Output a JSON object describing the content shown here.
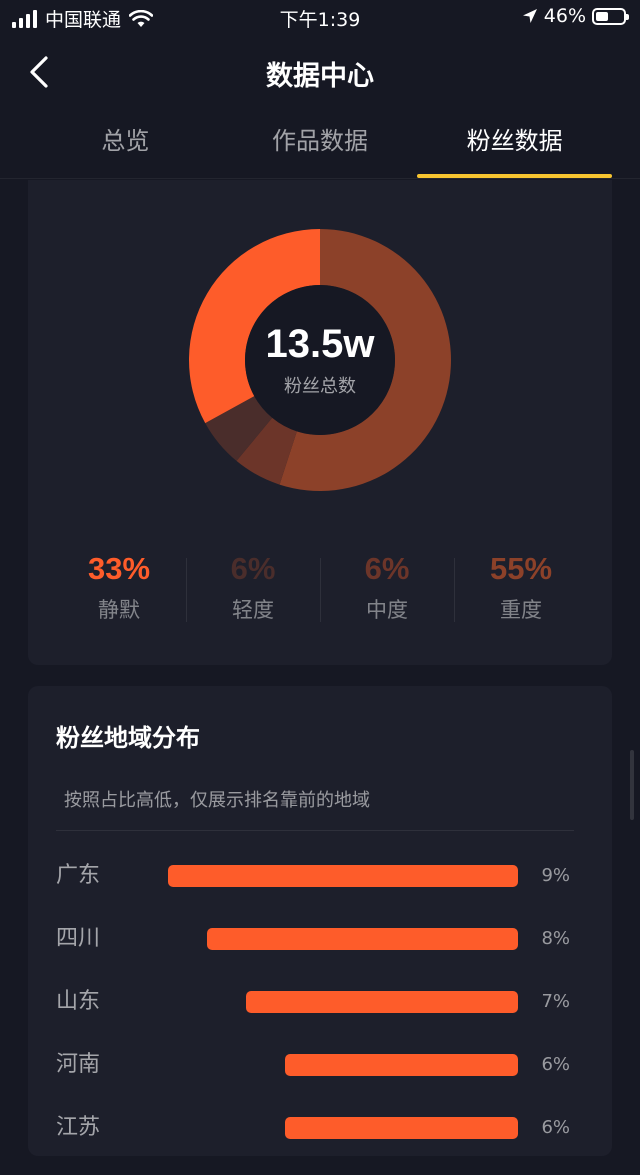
{
  "status_bar": {
    "carrier": "中国联通",
    "time": "下午1:39",
    "battery": "46%",
    "battery_level": 0.46
  },
  "nav": {
    "title": "数据中心"
  },
  "tabs": [
    {
      "label": "总览",
      "active": false
    },
    {
      "label": "作品数据",
      "active": false
    },
    {
      "label": "粉丝数据",
      "active": true
    }
  ],
  "fans": {
    "total": "13.5w",
    "total_label": "粉丝总数",
    "segments": [
      {
        "label": "静默",
        "percent_text": "33%",
        "value": 33,
        "color": "#fe5c2a"
      },
      {
        "label": "轻度",
        "percent_text": "6%",
        "value": 6,
        "color": "#4a2d2b"
      },
      {
        "label": "中度",
        "percent_text": "6%",
        "value": 6,
        "color": "#6c3529"
      },
      {
        "label": "重度",
        "percent_text": "55%",
        "value": 55,
        "color": "#8c4129"
      }
    ]
  },
  "region": {
    "title": "粉丝地域分布",
    "description": "按照占比高低，仅展示排名靠前的地域",
    "items": [
      {
        "name": "广东",
        "percent_text": "9%",
        "value": 9
      },
      {
        "name": "四川",
        "percent_text": "8%",
        "value": 8
      },
      {
        "name": "山东",
        "percent_text": "7%",
        "value": 7
      },
      {
        "name": "河南",
        "percent_text": "6%",
        "value": 6
      },
      {
        "name": "江苏",
        "percent_text": "6%",
        "value": 6
      }
    ],
    "bar_color": "#fe5c2a"
  }
}
